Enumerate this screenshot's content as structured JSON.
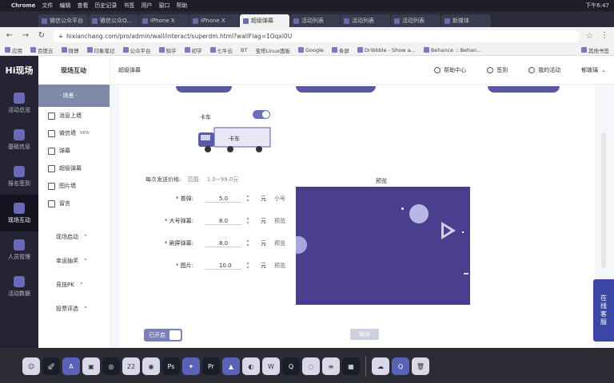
{
  "menubar": {
    "apple": "",
    "app": "Chrome",
    "items": [
      "文件",
      "编辑",
      "查看",
      "历史记录",
      "书签",
      "用户",
      "窗口",
      "帮助"
    ],
    "clock": "下午6:47"
  },
  "tabs": [
    {
      "label": "微信公众平台",
      "active": false
    },
    {
      "label": "微信公众Q...",
      "active": false
    },
    {
      "label": "iPhone X",
      "active": false
    },
    {
      "label": "iPhone X",
      "active": false
    },
    {
      "label": "超级弹幕",
      "active": true
    },
    {
      "label": "活动列表",
      "active": false
    },
    {
      "label": "活动列表",
      "active": false
    },
    {
      "label": "活动列表",
      "active": false
    },
    {
      "label": "新媒体",
      "active": false
    }
  ],
  "address": {
    "url": "hixianchang.com/pro/admin/wall/interact/superdm.html?wallFlag=1Oqxi0U"
  },
  "bookmarks": {
    "items": [
      "应用",
      "百度云",
      "微博",
      "印象笔记",
      "公众平台",
      "知乎",
      "初学",
      "七牛云",
      "BT",
      "宝塔Linux面板",
      "Google",
      "条屏",
      "Dribbble - Show a...",
      "Behance :: Behan..."
    ],
    "right": "其他书签"
  },
  "left_nav": {
    "logo": "Hi现场",
    "items": [
      {
        "label": "活动总览"
      },
      {
        "label": "基础信息"
      },
      {
        "label": "报名签到"
      },
      {
        "label": "现场互动"
      },
      {
        "label": "人员管理"
      },
      {
        "label": "活动数据"
      }
    ]
  },
  "sub_nav": {
    "title": "现场互动",
    "selected": "· 场景 ·",
    "items": [
      {
        "label": "消息上墙",
        "badge": ""
      },
      {
        "label": "微信墙",
        "badge": "NEW"
      },
      {
        "label": "弹幕",
        "badge": ""
      },
      {
        "label": "超级弹幕",
        "badge": ""
      },
      {
        "label": "图片墙",
        "badge": ""
      },
      {
        "label": "留言",
        "badge": ""
      }
    ],
    "groups": [
      "现场启动",
      "幸运抽奖",
      "竞技PK",
      "投票评选"
    ]
  },
  "topbar": {
    "breadcrumb": "超级弹幕",
    "links": [
      "帮助中心",
      "签到",
      "我的活动",
      "郁玻璃"
    ]
  },
  "form": {
    "car_label": "卡车",
    "truck_text": "卡车",
    "price_label": "每次发送价格:",
    "price_range_label": "范围:",
    "price_range": "1.0~99.0元",
    "rows": [
      {
        "label": "* 普弹:",
        "value": "5.0",
        "unit": "元",
        "note": "小号"
      },
      {
        "label": "* 大号弹幕:",
        "value": "8.0",
        "unit": "元",
        "note": "预览"
      },
      {
        "label": "* 刷屏弹幕:",
        "value": "8.0",
        "unit": "元",
        "note": "预览"
      },
      {
        "label": "* 图片:",
        "value": "10.0",
        "unit": "元",
        "note": "预览"
      }
    ],
    "preview_title": "预览",
    "open_label": "已开启",
    "save_label": "保存"
  },
  "service": {
    "label": "在线客服"
  },
  "dock": {
    "icons": [
      "finder",
      "launchpad",
      "app-store",
      "preview",
      "safari",
      "calendar",
      "chrome",
      "photoshop",
      "nav",
      "premiere",
      "keynote",
      "siri",
      "wps",
      "qq",
      "wechat",
      "notes",
      "photos",
      "baidu",
      "quicktime",
      "trash"
    ],
    "calendar_day": "22",
    "ps_label": "Ps",
    "pr_label": "Pr"
  }
}
